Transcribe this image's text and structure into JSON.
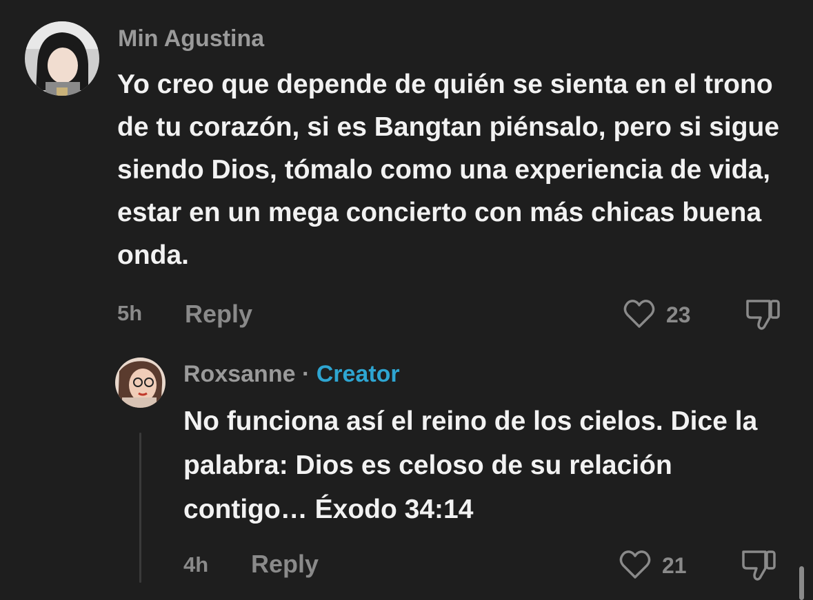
{
  "comments": [
    {
      "username": "Min Agustina",
      "text": "Yo creo que depende de quién se sienta en el trono de tu corazón, si es Bangtan piénsalo, pero si sigue siendo Dios, tómalo como una experiencia de vida, estar en un mega concierto con más chicas buena onda.",
      "time": "5h",
      "reply_label": "Reply",
      "likes": "23"
    }
  ],
  "reply": {
    "username": "Roxsanne",
    "separator": "·",
    "badge": "Creator",
    "text": "No funciona así el reino de los cielos. Dice la palabra: Dios es celoso de su relación contigo… Éxodo 34:14",
    "time": "4h",
    "reply_label": "Reply",
    "likes": "21"
  },
  "icons": {
    "like": "heart-outline-icon",
    "dislike": "thumbs-down-outline-icon"
  },
  "colors": {
    "background": "#1e1e1e",
    "text": "#f2f2f2",
    "muted": "#8a8a8a",
    "creator_badge": "#2ea5d1"
  }
}
